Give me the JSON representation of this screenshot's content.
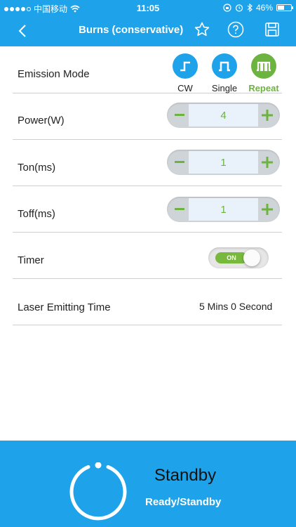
{
  "status_bar": {
    "carrier": "中国移动",
    "time": "11:05",
    "battery": "46%"
  },
  "nav": {
    "title": "Burns (conservative)"
  },
  "emission": {
    "label": "Emission Mode",
    "modes": [
      {
        "label": "CW",
        "active": false
      },
      {
        "label": "Single",
        "active": false
      },
      {
        "label": "Repeat",
        "active": true
      }
    ]
  },
  "power": {
    "label": "Power(W)",
    "value": "4"
  },
  "ton": {
    "label": "Ton(ms)",
    "value": "1"
  },
  "toff": {
    "label": "Toff(ms)",
    "value": "1"
  },
  "timer": {
    "label": "Timer",
    "state": "ON"
  },
  "emitting_time": {
    "label": "Laser Emitting Time",
    "value": "5 Mins 0 Second"
  },
  "status": {
    "title": "Standby",
    "subtitle": "Ready/Standby"
  },
  "colors": {
    "primary": "#1ea3ea",
    "accent_green": "#6db33f",
    "mode_blue": "#1ea3ea",
    "mode_green": "#6db33f"
  }
}
